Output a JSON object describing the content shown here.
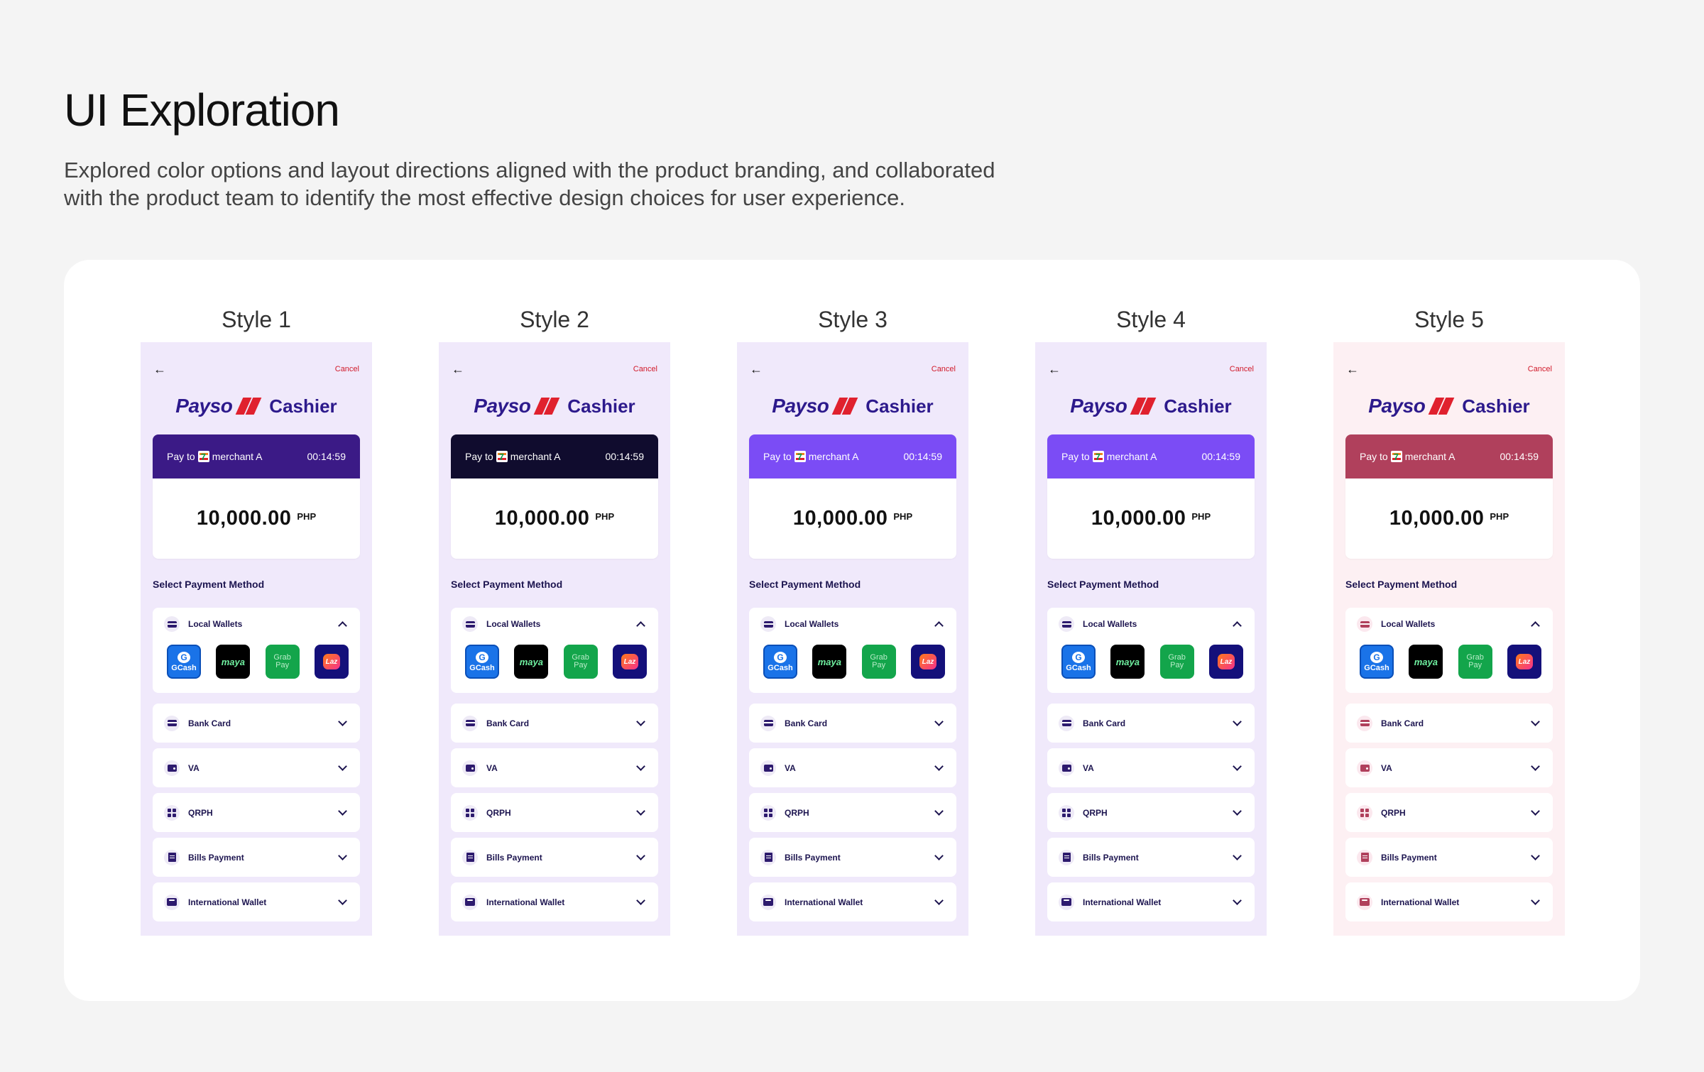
{
  "page": {
    "title": "UI Exploration",
    "description_line1": "Explored color options and layout directions aligned with the product branding, and collaborated",
    "description_line2": "with the product team to identify the most effective design choices for user experience."
  },
  "common": {
    "back_icon": "arrow-left-icon",
    "cancel_label": "Cancel",
    "brand_name": "Payso",
    "brand_suffix": "Cashier",
    "pay_to_prefix": "Pay to",
    "merchant": "merchant A",
    "timer": "00:14:59",
    "amount": "10,000.00",
    "currency": "PHP",
    "select_title": "Select Payment Method",
    "local_wallets_label": "Local Wallets",
    "wallets": [
      {
        "name": "GCash",
        "line1": "G",
        "line2": "GCash"
      },
      {
        "name": "maya",
        "line1": "maya",
        "line2": ""
      },
      {
        "name": "GrabPay",
        "line1": "Grab",
        "line2": "Pay"
      },
      {
        "name": "Lazada",
        "line1": "Laz",
        "line2": ""
      }
    ],
    "methods": [
      {
        "label": "Bank Card",
        "icon": "card-icon"
      },
      {
        "label": "VA",
        "icon": "wallet-icon"
      },
      {
        "label": "QRPH",
        "icon": "qr-code-icon"
      },
      {
        "label": "Bills Payment",
        "icon": "bill-icon"
      },
      {
        "label": "International Wallet",
        "icon": "international-wallet-icon"
      }
    ]
  },
  "styles": [
    {
      "label": "Style 1",
      "bg": "#f0e9fb",
      "accent": "#3b1a86",
      "icon": "#2d1a6e",
      "icbg": "#eeeaf6"
    },
    {
      "label": "Style 2",
      "bg": "#f0e9fb",
      "accent": "#100c2e",
      "icon": "#2d1a6e",
      "icbg": "#eeeaf6"
    },
    {
      "label": "Style 3",
      "bg": "#f0e9fb",
      "accent": "#7b4cf5",
      "icon": "#2d1a6e",
      "icbg": "#eeeaf6"
    },
    {
      "label": "Style 4",
      "bg": "#f0e9fb",
      "accent": "#7b4cf5",
      "icon": "#2d1a6e",
      "icbg": "#eeeaf6"
    },
    {
      "label": "Style 5",
      "bg": "#fdf0f3",
      "accent": "#b0405c",
      "icon": "#b0405c",
      "icbg": "#fbe8ee"
    }
  ]
}
